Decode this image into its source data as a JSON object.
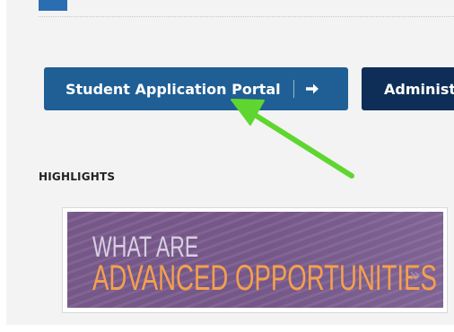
{
  "buttons": {
    "student_portal_label": "Student Application Portal",
    "admin_label": "Administ"
  },
  "highlights": {
    "title": "HIGHLIGHTS",
    "banner": {
      "line1": "WHAT ARE",
      "line2": "ADVANCED OPPORTUNITIES",
      "chevrons": "»"
    }
  },
  "icons": {
    "student_button_icon": "arrow-right-icon",
    "annotation": "green-pointer-arrow-icon"
  },
  "colors": {
    "student_button": "#1f5f95",
    "admin_button": "#0e2e57",
    "banner_background": "#7a5c8e",
    "banner_accent": "#f6a04c",
    "annotation_arrow": "#66e23a"
  }
}
